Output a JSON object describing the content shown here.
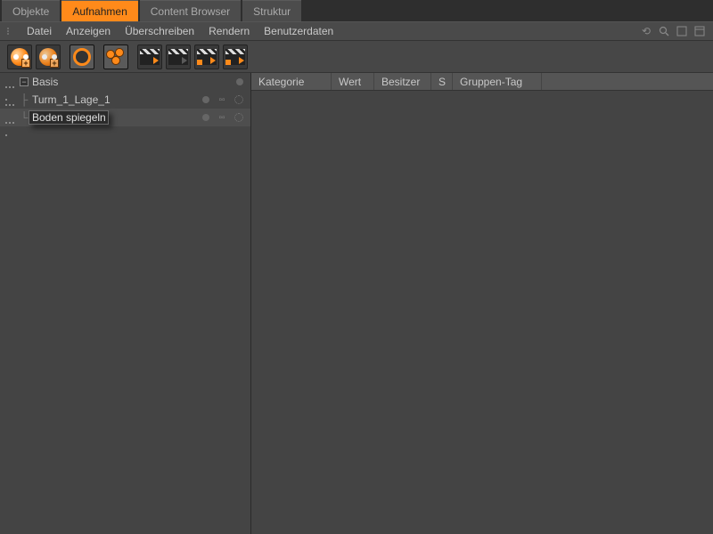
{
  "tabs": [
    {
      "label": "Objekte",
      "active": false
    },
    {
      "label": "Aufnahmen",
      "active": true
    },
    {
      "label": "Content Browser",
      "active": false
    },
    {
      "label": "Struktur",
      "active": false
    }
  ],
  "menu": {
    "items": [
      "Datei",
      "Anzeigen",
      "Überschreiben",
      "Rendern",
      "Benutzerdaten"
    ]
  },
  "tree": {
    "root": {
      "label": "Basis"
    },
    "child1": {
      "label": "Turm_1_Lage_1"
    },
    "child2_rename_value": "Boden spiegelnd"
  },
  "prop_headers": [
    "Kategorie",
    "Wert",
    "Besitzer",
    "S",
    "Gruppen-Tag"
  ],
  "icons": {
    "tool_new_take": "new-take",
    "tool_add_take": "add-take",
    "tool_auto_take": "auto-take",
    "tool_nodes": "nodes",
    "tool_render": "render-take",
    "tool_render_grey": "render-take-disabled",
    "tool_render_marked": "render-take-marked",
    "tool_render_all": "render-take-all"
  }
}
